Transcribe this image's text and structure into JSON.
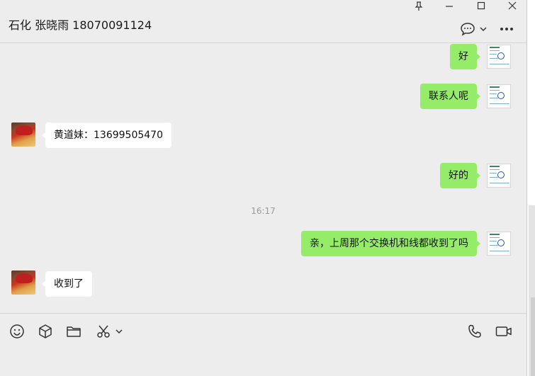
{
  "window": {
    "title": "石化 张晓雨 18070091124"
  },
  "messages": [
    {
      "side": "me",
      "text": "好"
    },
    {
      "side": "me",
      "text": "联系人呢"
    },
    {
      "side": "them",
      "text": "黄道妹：13699505470"
    },
    {
      "side": "me",
      "text": "好的"
    },
    {
      "side": "time",
      "text": "16:17"
    },
    {
      "side": "me",
      "text": "亲，上周那个交换机和线都收到了吗"
    },
    {
      "side": "them",
      "text": "收到了"
    }
  ],
  "toolbar": {
    "left_icons": [
      "emoji-icon",
      "cube-icon",
      "folder-icon",
      "scissors-icon",
      "chevron-down-icon"
    ],
    "right_icons": [
      "phone-icon",
      "video-icon"
    ]
  },
  "colors": {
    "background": "#ededed",
    "self_bubble": "#95ec69",
    "other_bubble": "#ffffff"
  }
}
